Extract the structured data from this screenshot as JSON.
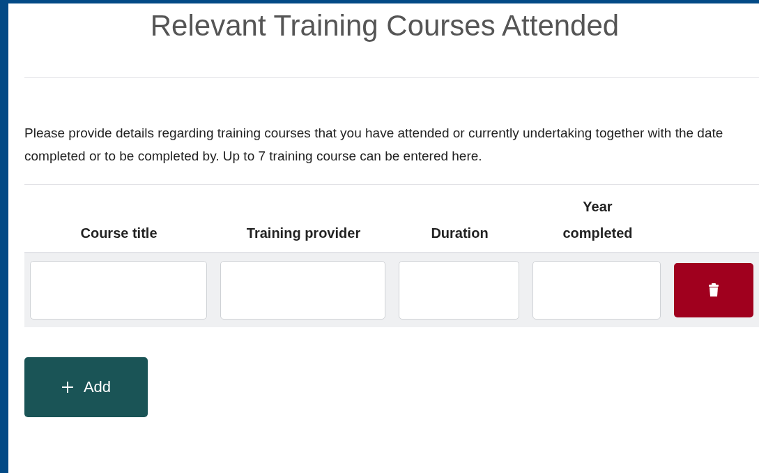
{
  "title": "Relevant Training Courses Attended",
  "intro": "Please provide details regarding training courses that you have attended or currently undertaking together with the date completed or to be completed by. Up to 7 training course can be entered here.",
  "table": {
    "columns": [
      "Course title",
      "Training provider",
      "Duration",
      "Year completed"
    ]
  },
  "add_button": {
    "label": "Add"
  }
}
